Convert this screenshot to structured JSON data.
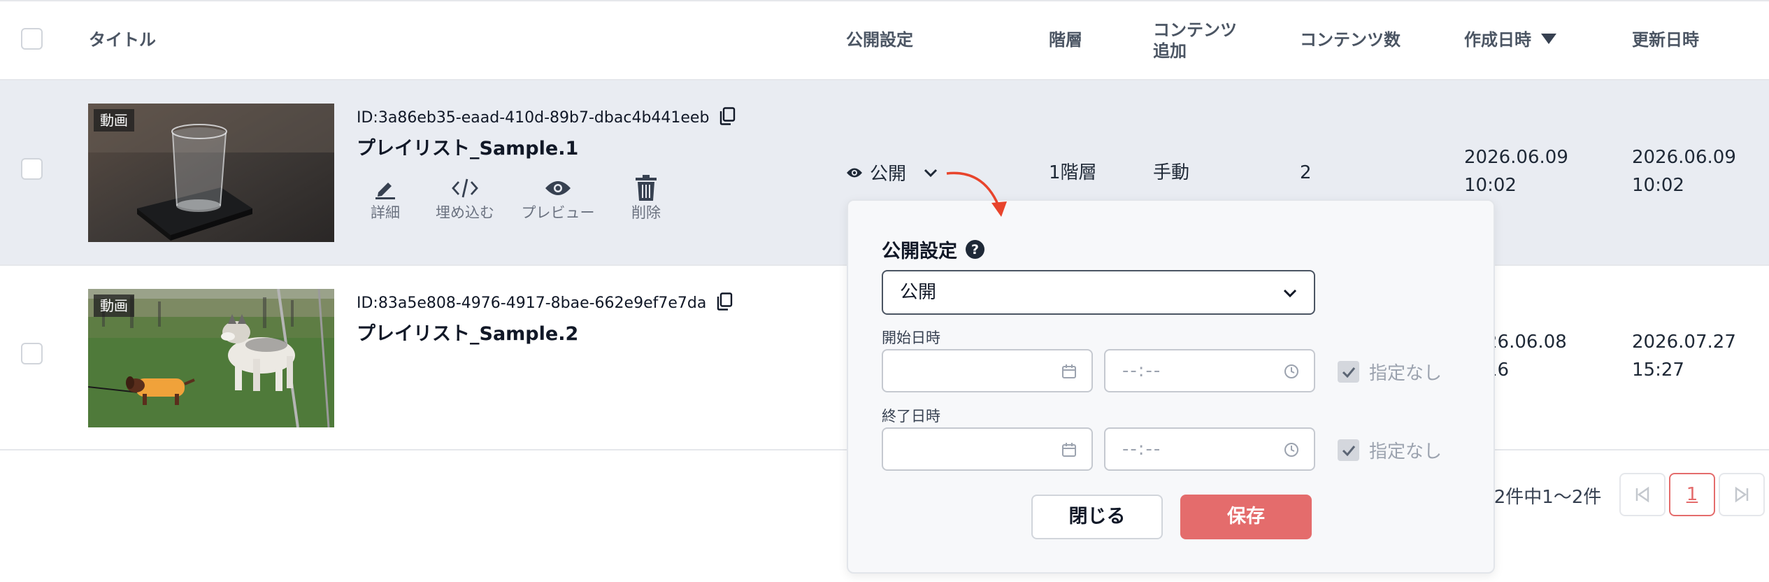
{
  "header": {
    "title": "タイトル",
    "publish_setting": "公開設定",
    "hierarchy": "階層",
    "content_add_line1": "コンテンツ",
    "content_add_line2": "追加",
    "content_count": "コンテンツ数",
    "created_at": "作成日時",
    "updated_at": "更新日時"
  },
  "rows": [
    {
      "badge": "動画",
      "id": "ID:3a86eb35-eaad-410d-89b7-dbac4b441eeb",
      "title": "プレイリスト_Sample.1",
      "actions": [
        "詳細",
        "埋め込む",
        "プレビュー",
        "削除"
      ],
      "publish": "公開",
      "hierarchy": "1階層",
      "content_add": "手動",
      "content_count": "2",
      "created_date": "2026.06.09",
      "created_time": "10:02",
      "updated_date": "2026.06.09",
      "updated_time": "10:02"
    },
    {
      "badge": "動画",
      "id": "ID:83a5e808-4976-4917-8bae-662e9ef7e7da",
      "title": "プレイリスト_Sample.2",
      "created_date": "26.06.08",
      "created_time": "16",
      "updated_date": "2026.07.27",
      "updated_time": "15:27"
    }
  ],
  "popover": {
    "title": "公開設定",
    "help": "?",
    "select_value": "公開",
    "start_label": "開始日時",
    "end_label": "終了日時",
    "time_placeholder": "--:--",
    "unspecified": "指定なし",
    "close": "閉じる",
    "save": "保存"
  },
  "pagination": {
    "summary": ":2件中1〜2件",
    "current_page": "1"
  },
  "colors": {
    "accent": "#e46c6c",
    "selected_row": "#e9ecf2",
    "annotation_arrow": "#e8442c"
  },
  "icons": [
    "copy-icon",
    "pencil-icon",
    "code-icon",
    "eye-icon",
    "trash-icon",
    "chevron-down-icon",
    "calendar-icon",
    "clock-icon",
    "check-icon",
    "first-page-icon",
    "last-page-icon",
    "sort-desc-icon"
  ]
}
